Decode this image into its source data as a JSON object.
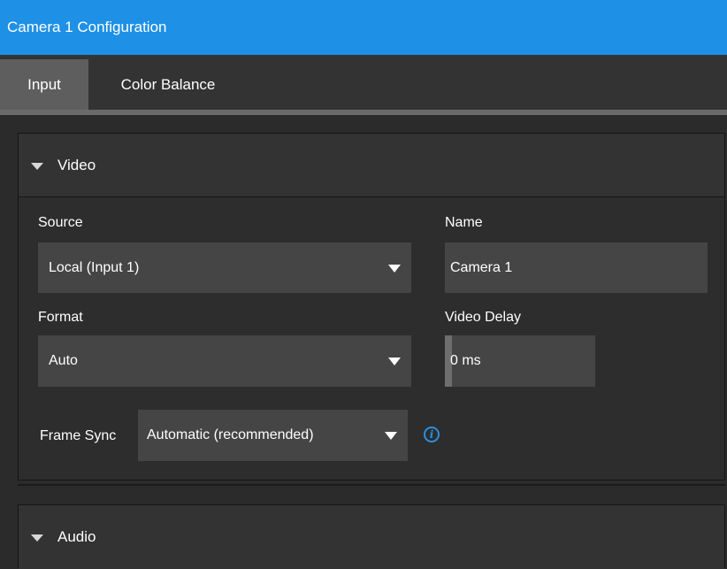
{
  "window": {
    "title": "Camera 1 Configuration"
  },
  "tabs": [
    {
      "label": "Input",
      "active": true
    },
    {
      "label": "Color Balance",
      "active": false
    }
  ],
  "video": {
    "header": "Video",
    "source": {
      "label": "Source",
      "value": "Local (Input 1)"
    },
    "name": {
      "label": "Name",
      "value": "Camera 1"
    },
    "format": {
      "label": "Format",
      "value": "Auto"
    },
    "video_delay": {
      "label": "Video Delay",
      "value": "0 ms"
    },
    "frame_sync": {
      "label": "Frame Sync",
      "value": "Automatic (recommended)"
    }
  },
  "audio": {
    "header": "Audio"
  },
  "icons": {
    "section_toggle": "triangle-down-icon",
    "dropdown_caret": "caret-down-icon",
    "info": "info-icon"
  },
  "colors": {
    "title_bar": "#1e90e6",
    "info_accent": "#2b8fe0",
    "background": "#2b2b2b",
    "field": "#454545"
  }
}
